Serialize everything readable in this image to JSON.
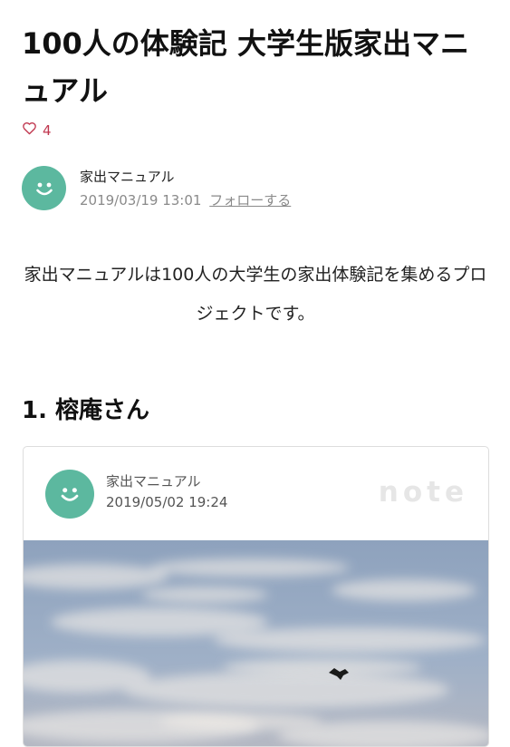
{
  "article": {
    "title": "100人の体験記 大学生版家出マニュアル",
    "like_count": "4",
    "author": {
      "name": "家出マニュアル",
      "date": "2019/03/19 13:01",
      "follow_label": "フォローする"
    },
    "intro": "家出マニュアルは100人の大学生の家出体験記を集めるプロジェクトです。",
    "section_heading": "1. 榕庵さん"
  },
  "embed": {
    "author": "家出マニュアル",
    "date": "2019/05/02 19:24",
    "logo": "note"
  },
  "colors": {
    "avatar": "#5cb89f",
    "like": "#c0364e",
    "sky": "#8fa6c2"
  },
  "icons": {
    "like": "heart-outline-icon",
    "avatar": "smiley-face-icon"
  }
}
